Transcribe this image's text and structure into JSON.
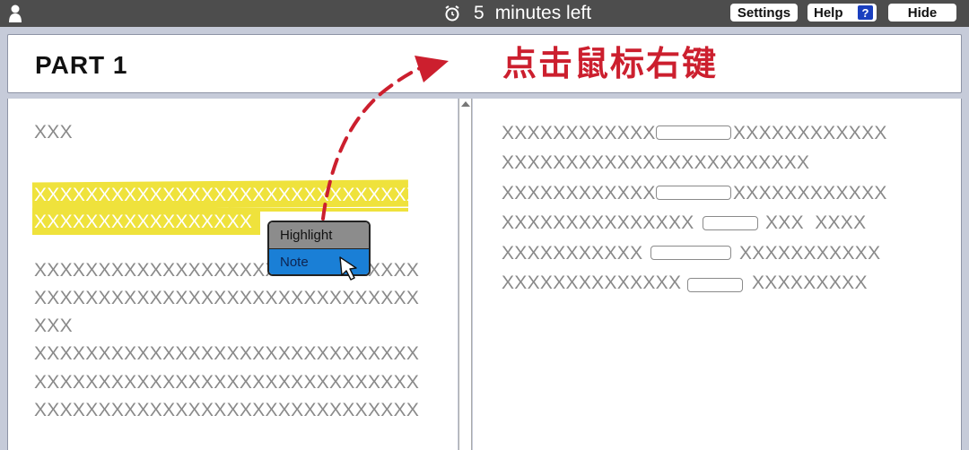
{
  "topbar": {
    "timer_number": "5",
    "timer_text": "minutes left",
    "settings_label": "Settings",
    "help_label": "Help",
    "help_icon_label": "?",
    "hide_label": "Hide"
  },
  "header": {
    "title": "PART 1"
  },
  "left_pane": {
    "heading": "XXX",
    "highlighted_lines": [
      "XXXXXXXXXXXXXXXXXXXXXXXXXXXXXX",
      "XXXXXXXXXXXXXXXXX"
    ],
    "body_lines": [
      "XXXXXXXXXXXXXXXXXXXXXXXXXXXXXX",
      "XXXXXXXXXXXXXXXXXXXXXXXXXXXXXX",
      "XXX",
      "XXXXXXXXXXXXXXXXXXXXXXXXXXXXXX",
      "XXXXXXXXXXXXXXXXXXXXXXXXXXXXXX",
      "XXXXXXXXXXXXXXXXXXXXXXXXXXXXXX"
    ]
  },
  "context_menu": {
    "highlight_label": "Highlight",
    "note_label": "Note"
  },
  "right_pane": {
    "lines": [
      {
        "before": "XXXXXXXXXXXX",
        "after": "XXXXXXXXXXXX"
      },
      {
        "before": "XXXXXXXXXXXXXXXXXXXXXXXX",
        "after": ""
      },
      {
        "before": "XXXXXXXXXXXX",
        "after": "XXXXXXXXXXXX"
      },
      {
        "before": "XXXXXXXXXXXXXXX",
        "after": "XXX  XXXX"
      },
      {
        "before": "XXXXXXXXXXX",
        "after": "XXXXXXXXXXX"
      },
      {
        "before": "XXXXXXXXXXXXXX",
        "after": "XXXXXXXXX"
      }
    ]
  },
  "annotation": {
    "text": "点击鼠标右键",
    "color": "#cc1f2e"
  },
  "colors": {
    "highlight": "#efe23c",
    "note": "#1a7fd6",
    "topbar": "#4d4d4d",
    "frame": "#c6cbd9"
  }
}
